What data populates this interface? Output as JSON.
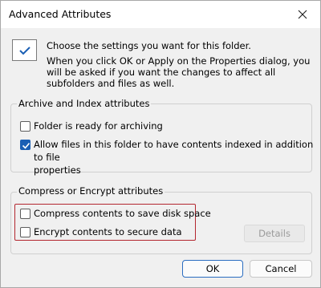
{
  "window": {
    "title": "Advanced Attributes"
  },
  "intro": {
    "line1": "Choose the settings you want for this folder.",
    "line2": "When you click OK or Apply on the Properties dialog, you will be asked if you want the changes to affect all subfolders and files as well."
  },
  "archive_group": {
    "label": "Archive and Index attributes",
    "items": [
      {
        "label": "Folder is ready for archiving",
        "checked": false
      },
      {
        "label_line1": "Allow files in this folder to have contents indexed in addition to file",
        "label_line2": "properties",
        "checked": true
      }
    ]
  },
  "compress_group": {
    "label": "Compress or Encrypt attributes",
    "items": [
      {
        "label": "Compress contents to save disk space",
        "checked": false
      },
      {
        "label": "Encrypt contents to secure data",
        "checked": false
      }
    ],
    "details_label": "Details"
  },
  "buttons": {
    "ok_label": "OK",
    "cancel_label": "Cancel"
  },
  "colors": {
    "accent": "#1a5fb4",
    "highlight_box": "#b3262f"
  }
}
